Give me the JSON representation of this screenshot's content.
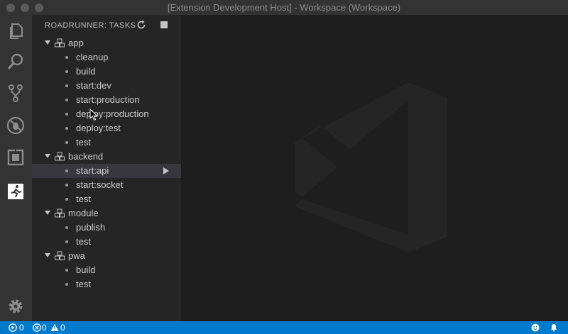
{
  "window": {
    "title": "[Extension Development Host] - Workspace (Workspace)"
  },
  "activity_bar": {
    "icons": [
      "files-icon",
      "search-icon",
      "source-control-icon",
      "debug-icon",
      "extensions-icon",
      "roadrunner-icon",
      "settings-gear-icon"
    ]
  },
  "sidebar": {
    "title": "ROADRUNNER: TASKS",
    "groups": [
      {
        "label": "app",
        "tasks": [
          "cleanup",
          "build",
          "start:dev",
          "start:production",
          "deploy:production",
          "deploy:test",
          "test"
        ]
      },
      {
        "label": "backend",
        "tasks": [
          "start:api",
          "start:socket",
          "test"
        ]
      },
      {
        "label": "module",
        "tasks": [
          "publish",
          "test"
        ]
      },
      {
        "label": "pwa",
        "tasks": [
          "build",
          "test"
        ]
      }
    ],
    "selected_task": "start:api"
  },
  "status_bar": {
    "tasks_running": "0",
    "errors": "0",
    "warnings": "0"
  },
  "colors": {
    "accent": "#007acc",
    "sidebar_bg": "#252526",
    "activity_bg": "#333333",
    "editor_bg": "#1e1e1e"
  }
}
